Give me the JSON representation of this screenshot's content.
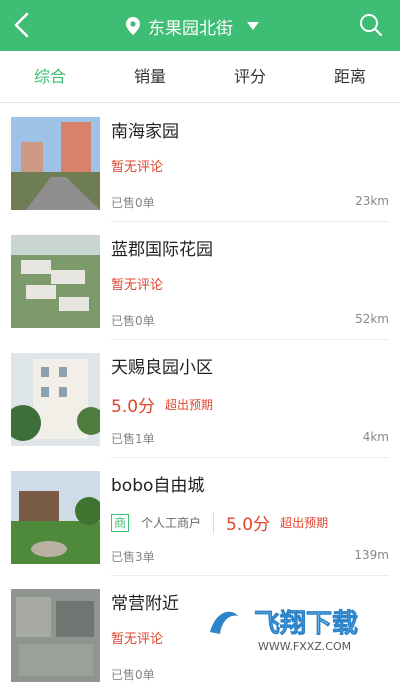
{
  "header": {
    "location": "东果园北街",
    "icons": {
      "back": "chevron-left-icon",
      "location": "location-pin-icon",
      "dropdown": "caret-down-icon",
      "search": "search-icon"
    }
  },
  "tabs": [
    {
      "label": "综合",
      "active": true
    },
    {
      "label": "销量",
      "active": false
    },
    {
      "label": "评分",
      "active": false
    },
    {
      "label": "距离",
      "active": false
    }
  ],
  "items": [
    {
      "name": "南海家园",
      "no_comment": "暂无评论",
      "sold": "已售0单",
      "distance": "23km"
    },
    {
      "name": "蓝郡国际花园",
      "no_comment": "暂无评论",
      "sold": "已售0单",
      "distance": "52km"
    },
    {
      "name": "天赐良园小区",
      "score": "5.0分",
      "tag": "超出预期",
      "sold": "已售1单",
      "distance": "4km"
    },
    {
      "name": "bobo自由城",
      "badge": "商",
      "merchant_type": "个人工商户",
      "score": "5.0分",
      "tag": "超出预期",
      "sold": "已售3单",
      "distance": "139m"
    },
    {
      "name": "常营附近",
      "no_comment": "暂无评论",
      "sold": "已售0单"
    }
  ],
  "watermark": {
    "title": "飞翔下载",
    "url": "WWW.FXXZ.COM"
  },
  "colors": {
    "accent": "#3ebd74",
    "price": "#e0442c",
    "muted": "#888888"
  }
}
